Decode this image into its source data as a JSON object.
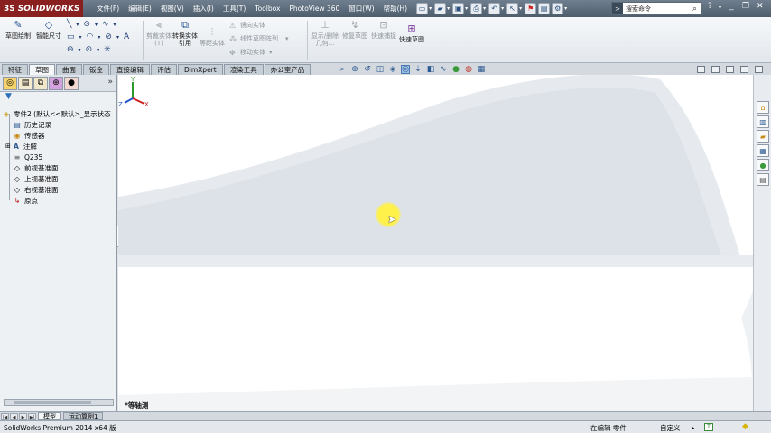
{
  "titlebar": {
    "app_name": "SOLIDWORKS",
    "menus": [
      "文件(F)",
      "编辑(E)",
      "视图(V)",
      "插入(I)",
      "工具(T)",
      "Toolbox",
      "PhotoView 360",
      "窗口(W)",
      "帮助(H)"
    ],
    "search_placeholder": "搜索命令",
    "help_icon": "?"
  },
  "command_manager": {
    "buttons": {
      "sketch": "草图绘制",
      "smart_dim": "智能尺寸",
      "cut_entities": "剪裁实体(T)",
      "convert_entities": "转换实体引用",
      "offset_entities": "等距实体",
      "display_delete": "显示/删除几何...",
      "repair_sketch": "修复草图",
      "rapid_sketch": "快速捕捉",
      "quick_sketch": "快速草图"
    },
    "small_commands": {
      "mirror": "镜向实体",
      "linear_pattern": "线性草图阵列",
      "move": "移动实体"
    }
  },
  "tabs": [
    "特征",
    "草图",
    "曲面",
    "钣金",
    "直接编辑",
    "评估",
    "DimXpert",
    "渲染工具",
    "办公室产品"
  ],
  "active_tab": "草图",
  "feature_tree": {
    "root": "零件2 (默认<<默认>_显示状态",
    "items": [
      "历史记录",
      "传感器",
      "注解",
      "Q235",
      "前视基准面",
      "上视基准面",
      "右视基准面",
      "原点"
    ]
  },
  "graphics": {
    "view_label": "*等轴测",
    "axes": {
      "x": "X",
      "y": "Y",
      "z": "Z"
    }
  },
  "model_tabs": [
    "模型",
    "运动算例1"
  ],
  "active_model_tab": "模型",
  "statusbar": {
    "version": "SolidWorks Premium 2014 x64 版",
    "editing": "在编辑 零件",
    "custom": "自定义"
  }
}
